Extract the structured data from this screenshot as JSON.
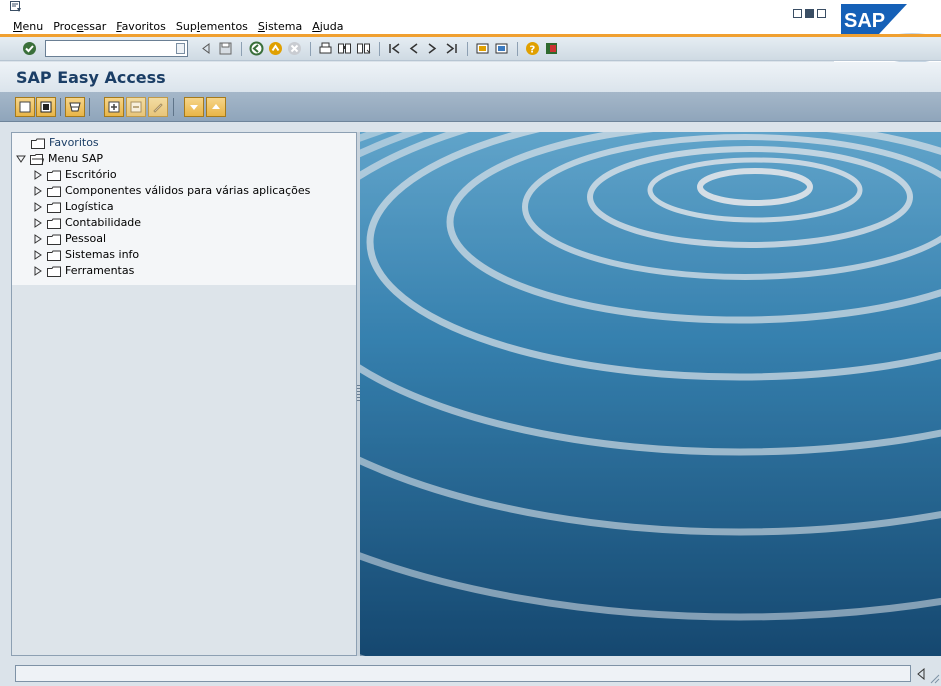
{
  "menu": {
    "items": [
      {
        "label": "Menu",
        "u": "M",
        "rest": "enu"
      },
      {
        "label": "Processar",
        "pre": "Proc",
        "u": "e",
        "rest": "ssar"
      },
      {
        "label": "Favoritos",
        "u": "F",
        "rest": "avoritos"
      },
      {
        "label": "Suplementos",
        "pre": "Sup",
        "u": "l",
        "rest": "ementos"
      },
      {
        "label": "Sistema",
        "u": "S",
        "rest": "istema"
      },
      {
        "label": "Ajuda",
        "u": "A",
        "rest": "juda"
      }
    ]
  },
  "logo_text": "SAP",
  "command_field": {
    "value": ""
  },
  "title": "SAP Easy Access",
  "tree": {
    "favorites": "Favoritos",
    "menu_root": "Menu SAP",
    "items": [
      "Escritório",
      "Componentes válidos para várias aplicações",
      "Logística",
      "Contabilidade",
      "Pessoal",
      "Sistemas info",
      "Ferramentas"
    ]
  },
  "colors": {
    "brand_blue": "#1b3e66",
    "accent_orange": "#f0a030",
    "toolbar_button": "#e9b547"
  },
  "status": {
    "message": ""
  }
}
